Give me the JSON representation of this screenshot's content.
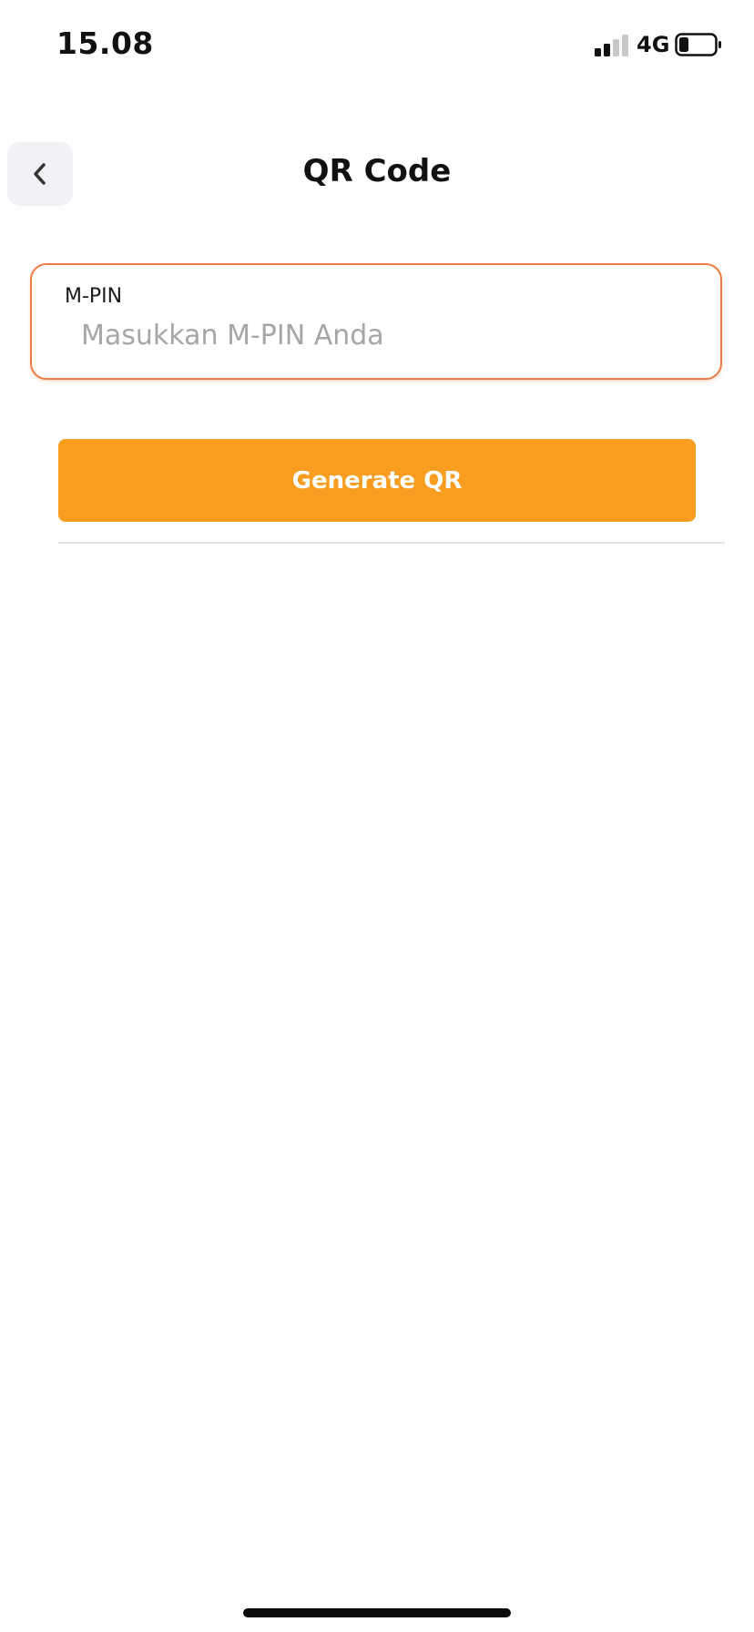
{
  "status_bar": {
    "time": "15.08",
    "network": "4G",
    "icons": [
      "signal-icon",
      "battery-icon"
    ]
  },
  "header": {
    "title": "QR Code",
    "back_icon": "chevron-left-icon"
  },
  "pin_field": {
    "label": "M-PIN",
    "placeholder": "Masukkan M-PIN Anda",
    "value": ""
  },
  "actions": {
    "generate_label": "Generate QR"
  },
  "colors": {
    "accent": "#f99d21",
    "field_border": "#f07a43",
    "back_button_bg": "#f0f1f5",
    "placeholder": "#a6a6a6"
  }
}
